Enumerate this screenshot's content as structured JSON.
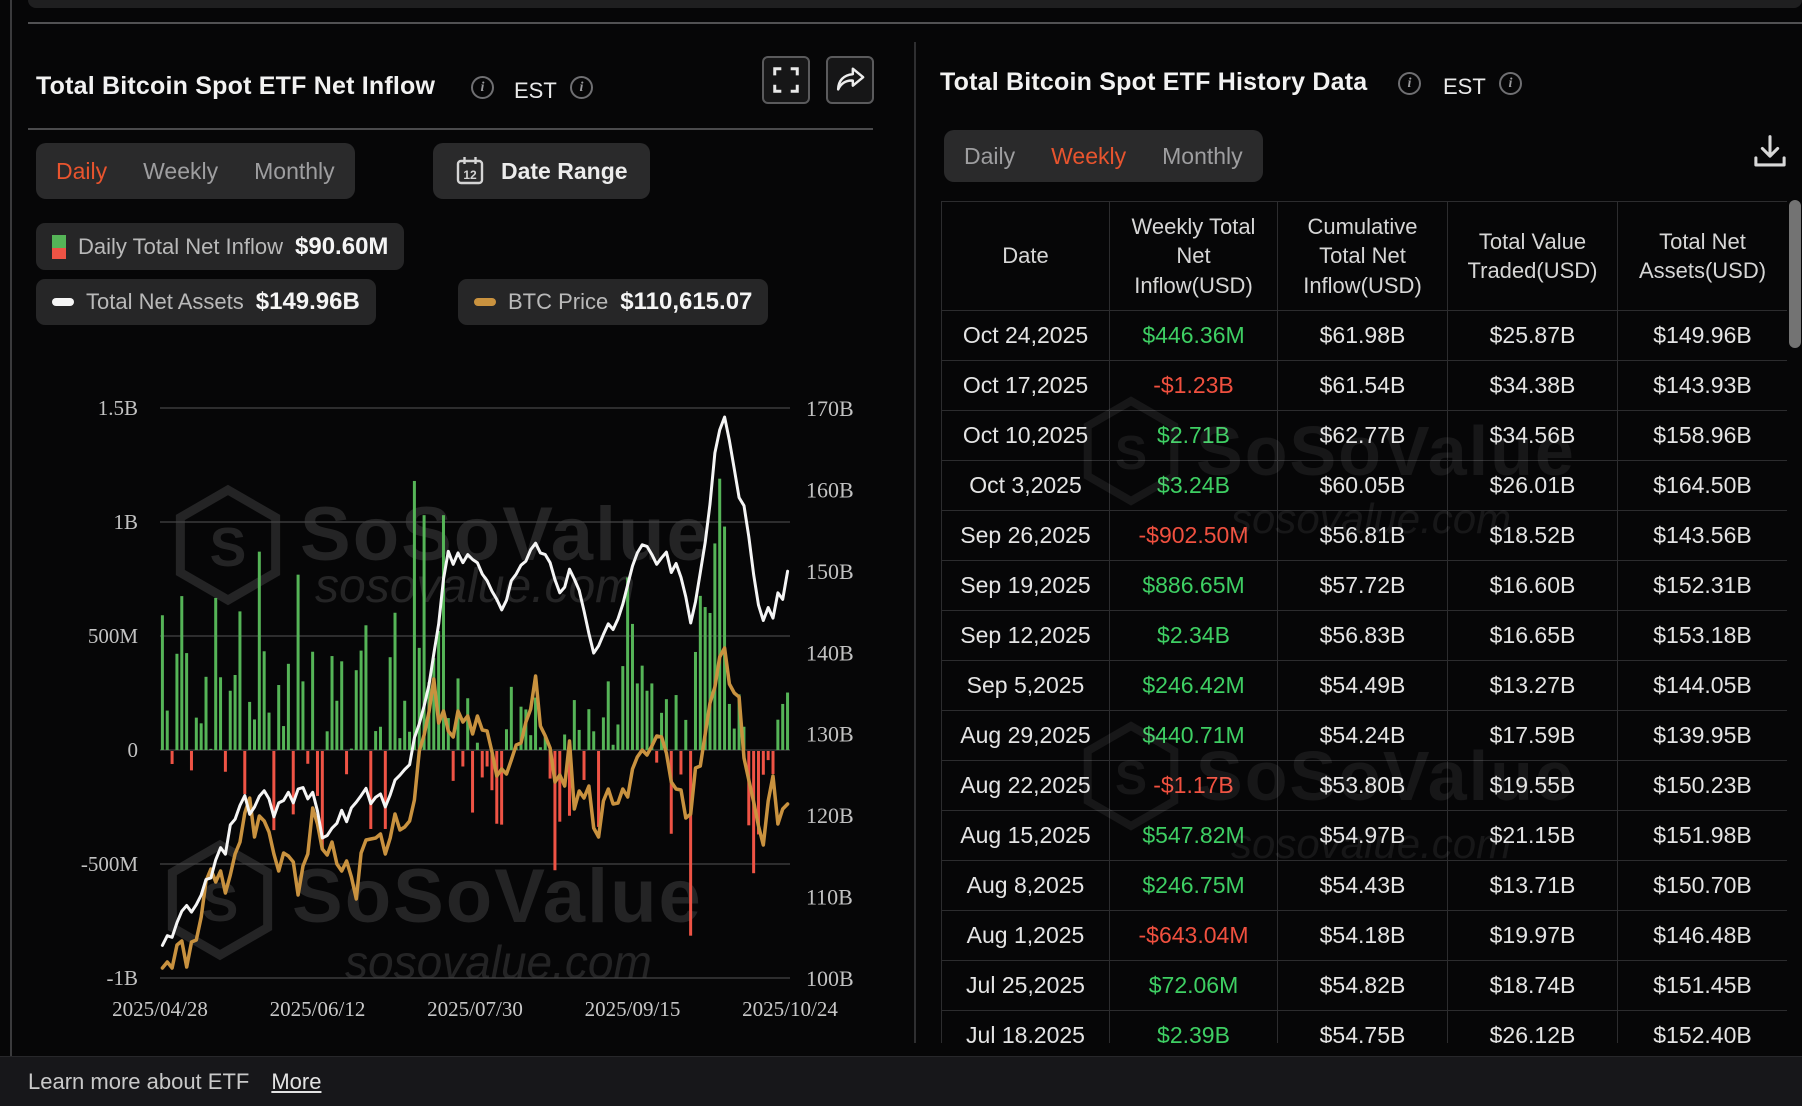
{
  "left_panel": {
    "title": "Total Bitcoin Spot ETF Net Inflow",
    "est_label": "EST",
    "tabs": [
      "Daily",
      "Weekly",
      "Monthly"
    ],
    "active_tab": "Daily",
    "date_range_label": "Date Range",
    "calendar_day": "12",
    "legend": [
      {
        "label": "Daily Total Net Inflow",
        "value": "$90.60M",
        "icon": "green-red-bar-icon"
      },
      {
        "label": "Total Net Assets",
        "value": "$149.96B",
        "icon": "white-line-icon"
      },
      {
        "label": "BTC Price",
        "value": "$110,615.07",
        "icon": "orange-line-icon"
      }
    ]
  },
  "right_panel": {
    "title": "Total Bitcoin Spot ETF History Data",
    "est_label": "EST",
    "tabs": [
      "Daily",
      "Weekly",
      "Monthly"
    ],
    "active_tab": "Weekly",
    "table": {
      "headers": [
        "Date",
        "Weekly Total Net Inflow(USD)",
        "Cumulative Total Net Inflow(USD)",
        "Total Value Traded(USD)",
        "Total Net Assets(USD)"
      ],
      "rows": [
        [
          "Oct 24,2025",
          "$446.36M",
          "$61.98B",
          "$25.87B",
          "$149.96B"
        ],
        [
          "Oct 17,2025",
          "-$1.23B",
          "$61.54B",
          "$34.38B",
          "$143.93B"
        ],
        [
          "Oct 10,2025",
          "$2.71B",
          "$62.77B",
          "$34.56B",
          "$158.96B"
        ],
        [
          "Oct 3,2025",
          "$3.24B",
          "$60.05B",
          "$26.01B",
          "$164.50B"
        ],
        [
          "Sep 26,2025",
          "-$902.50M",
          "$56.81B",
          "$18.52B",
          "$143.56B"
        ],
        [
          "Sep 19,2025",
          "$886.65M",
          "$57.72B",
          "$16.60B",
          "$152.31B"
        ],
        [
          "Sep 12,2025",
          "$2.34B",
          "$56.83B",
          "$16.65B",
          "$153.18B"
        ],
        [
          "Sep 5,2025",
          "$246.42M",
          "$54.49B",
          "$13.27B",
          "$144.05B"
        ],
        [
          "Aug 29,2025",
          "$440.71M",
          "$54.24B",
          "$17.59B",
          "$139.95B"
        ],
        [
          "Aug 22,2025",
          "-$1.17B",
          "$53.80B",
          "$19.55B",
          "$150.23B"
        ],
        [
          "Aug 15,2025",
          "$547.82M",
          "$54.97B",
          "$21.15B",
          "$151.98B"
        ],
        [
          "Aug 8,2025",
          "$246.75M",
          "$54.43B",
          "$13.71B",
          "$150.70B"
        ],
        [
          "Aug 1,2025",
          "-$643.04M",
          "$54.18B",
          "$19.97B",
          "$146.48B"
        ],
        [
          "Jul 25,2025",
          "$72.06M",
          "$54.82B",
          "$18.74B",
          "$151.45B"
        ],
        [
          "Jul 18,2025",
          "$2.39B",
          "$54.75B",
          "$26.12B",
          "$152.40B"
        ]
      ]
    }
  },
  "footer": {
    "learn_more": "Learn more about ETF",
    "more_link": "More"
  },
  "watermark": {
    "brand": "SoSoValue",
    "domain": "sosovalue.com",
    "logo_glyph": "S"
  },
  "icons": {
    "info_glyph": "i"
  },
  "chart_data": {
    "type": "bar",
    "title": "Total Bitcoin Spot ETF Net Inflow",
    "x_range": [
      "2025/04/28",
      "2025/10/24"
    ],
    "x_tick_labels": [
      "2025/04/28",
      "2025/06/12",
      "2025/07/30",
      "2025/09/15",
      "2025/10/24"
    ],
    "left_axis": {
      "tick_labels": [
        "1.5B",
        "1B",
        "500M",
        "0",
        "-500M",
        "-1B"
      ],
      "tick_values_M": [
        1500,
        1000,
        500,
        0,
        -500,
        -1000
      ]
    },
    "right_axis": {
      "tick_labels": [
        "170B",
        "160B",
        "150B",
        "140B",
        "130B",
        "120B",
        "110B",
        "100B"
      ],
      "range_B": [
        100,
        170
      ]
    },
    "series": [
      {
        "name": "Daily Total Net Inflow",
        "type": "bar",
        "unit": "USD millions",
        "values": [
          591,
          173,
          -57,
          422,
          675,
          425,
          -85,
          142,
          117,
          321,
          5,
          667,
          319,
          -91,
          260,
          329,
          608,
          -189,
          211,
          134,
          870,
          433,
          164,
          -347,
          285,
          105,
          378,
          -278,
          769,
          301,
          -56,
          431,
          -197,
          -432,
          82,
          412,
          216,
          389,
          -102,
          6,
          350,
          436,
          547,
          -342,
          83,
          102,
          -342,
          407,
          602,
          52,
          216,
          80,
          1180,
          448,
          1030,
          297,
          403,
          522,
          1030,
          140,
          -131,
          314,
          -68,
          227,
          -270,
          32,
          -116,
          -68,
          -172,
          -319,
          -323,
          91,
          277,
          12,
          190,
          178,
          65,
          230,
          12,
          63,
          -121,
          -523,
          -310,
          68,
          -284,
          219,
          88,
          -127,
          179,
          82,
          -333,
          143,
          301,
          23,
          112,
          368,
          757,
          553,
          292,
          370,
          260,
          292,
          -51,
          163,
          223,
          -363,
          241,
          -103,
          132,
          -810,
          430,
          676,
          627,
          601,
          906,
          1190,
          980,
          202,
          94,
          244,
          102,
          -326,
          -536,
          -366,
          -104,
          -40,
          -101,
          133,
          202,
          252
        ]
      },
      {
        "name": "Total Net Assets",
        "type": "line",
        "unit": "USD billions",
        "values": [
          104.0,
          105.2,
          105.0,
          106.8,
          108.2,
          108.9,
          108.1,
          109.0,
          110.2,
          112.1,
          112.3,
          114.5,
          116.0,
          115.2,
          118.8,
          119.5,
          121.2,
          122.4,
          120.1,
          121.0,
          122.3,
          123.0,
          122.0,
          119.8,
          121.5,
          121.8,
          122.8,
          121.5,
          123.2,
          123.4,
          122.0,
          122.8,
          120.5,
          117.2,
          117.5,
          118.4,
          119.0,
          120.6,
          119.2,
          120.9,
          121.6,
          122.4,
          123.3,
          121.4,
          122.2,
          122.6,
          121.0,
          122.5,
          124.3,
          124.9,
          125.6,
          126.2,
          129.5,
          131.2,
          133.4,
          136.0,
          139.8,
          143.5,
          149.0,
          152.4,
          150.8,
          152.2,
          151.0,
          152.0,
          151.4,
          151.0,
          149.6,
          148.8,
          147.5,
          146.5,
          145.2,
          146.4,
          148.8,
          149.6,
          150.7,
          151.2,
          152.6,
          153.4,
          152.2,
          152.0,
          151.0,
          148.9,
          147.3,
          148.0,
          150.2,
          149.0,
          147.6,
          145.1,
          142.3,
          139.9,
          140.8,
          142.2,
          143.5,
          142.8,
          144.1,
          145.9,
          148.3,
          150.6,
          152.2,
          153.2,
          153.0,
          152.0,
          150.8,
          151.6,
          152.3,
          149.8,
          150.9,
          149.2,
          146.8,
          143.6,
          146.2,
          149.8,
          153.5,
          158.2,
          164.5,
          167.3,
          168.9,
          166.0,
          162.5,
          159.0,
          158.0,
          154.2,
          149.5,
          145.8,
          143.9,
          145.5,
          144.2,
          147.3,
          146.5,
          149.96
        ]
      },
      {
        "name": "BTC Price",
        "type": "line",
        "unit": "USD thousands",
        "values": [
          94.2,
          94.8,
          94.2,
          96.5,
          96.9,
          94.3,
          96.8,
          97.0,
          99.3,
          102.9,
          104.1,
          102.8,
          103.9,
          101.7,
          103.5,
          105.6,
          106.8,
          109.7,
          111.2,
          107.3,
          109.4,
          108.9,
          107.8,
          105.6,
          103.9,
          105.7,
          105.4,
          104.8,
          101.5,
          104.4,
          105.6,
          110.2,
          108.6,
          106.1,
          105.5,
          106.8,
          104.6,
          103.9,
          104.9,
          103.3,
          101.1,
          105.7,
          107.0,
          107.1,
          107.2,
          107.6,
          105.6,
          107.2,
          109.6,
          108.0,
          108.3,
          108.9,
          111.0,
          115.9,
          117.5,
          119.8,
          123.1,
          118.7,
          119.9,
          117.9,
          117.3,
          119.9,
          118.8,
          119.4,
          117.6,
          119.4,
          118.0,
          117.9,
          115.8,
          113.4,
          114.1,
          113.6,
          115.0,
          116.5,
          116.7,
          118.8,
          120.1,
          123.4,
          118.4,
          117.4,
          116.2,
          112.8,
          113.5,
          112.4,
          116.9,
          110.1,
          111.9,
          111.2,
          112.4,
          108.2,
          107.3,
          110.9,
          112.1,
          110.6,
          110.7,
          112.1,
          111.3,
          114.1,
          115.3,
          116.0,
          115.5,
          116.4,
          117.4,
          117.3,
          115.7,
          112.8,
          112.1,
          112.0,
          109.2,
          109.6,
          114.2,
          114.4,
          117.6,
          120.7,
          122.3,
          125.3,
          126.2,
          122.6,
          121.7,
          121.3,
          115.2,
          113.0,
          110.8,
          108.4,
          106.5,
          110.9,
          113.4,
          108.6,
          110.1,
          110.6
        ]
      }
    ],
    "colors": {
      "bar_positive": "#55b457",
      "bar_negative": "#ee5345",
      "net_assets_line": "#f5f5f5",
      "btc_price_line": "#c9923f",
      "grid": "#454546",
      "axis_text": "#c2c2c2",
      "accent": "#e8542e"
    },
    "legend_position": "top-left",
    "grid": true
  }
}
